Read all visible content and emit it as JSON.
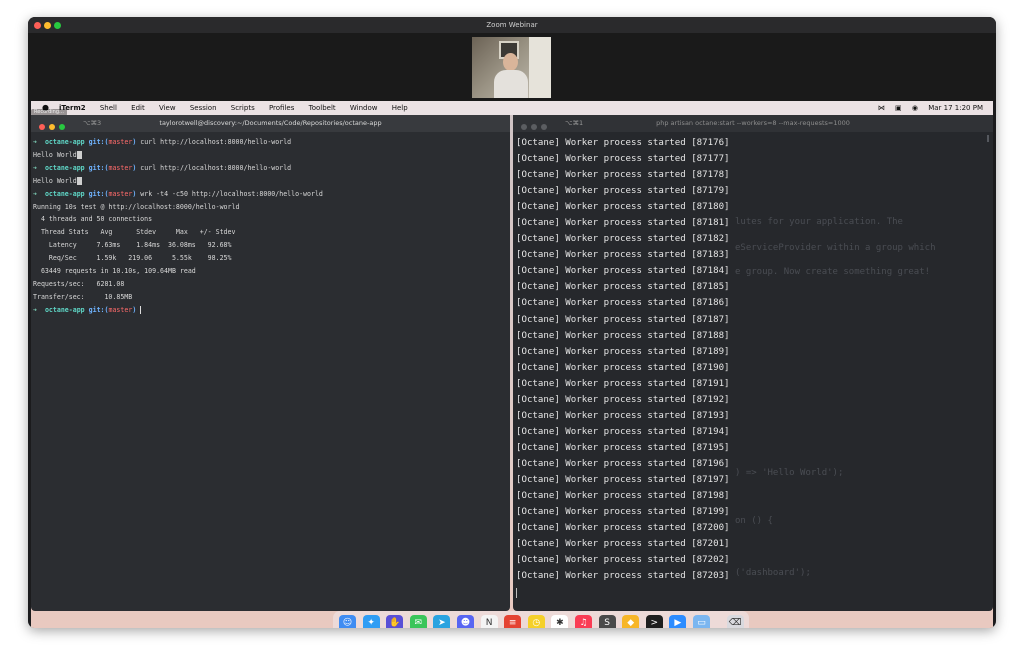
{
  "zoom": {
    "title": "Zoom Webinar"
  },
  "menubar": {
    "app": "iTerm2",
    "items": [
      "Shell",
      "Edit",
      "View",
      "Session",
      "Scripts",
      "Profiles",
      "Toolbelt",
      "Window",
      "Help"
    ],
    "datetime": "Mar 17  1:20 PM",
    "recording_badge": "Recording…"
  },
  "left_terminal": {
    "shortcut": "⌥⌘3",
    "title": "taylorotwell@discovery:~/Documents/Code/Repositories/octane-app",
    "prompt": {
      "arrow": "➜",
      "dir": "octane-app",
      "git": "git:(",
      "branch": "master",
      "close": ")"
    },
    "commands": [
      "curl http://localhost:8000/hello-world",
      "curl http://localhost:8000/hello-world",
      "wrk -t4 -c50 http://localhost:8000/hello-world"
    ],
    "responses": [
      "Hello World",
      "Hello World"
    ],
    "wrk_output": [
      "Running 10s test @ http://localhost:8000/hello-world",
      "  4 threads and 50 connections",
      "  Thread Stats   Avg      Stdev     Max   +/- Stdev",
      "    Latency     7.63ms    1.84ms  36.08ms   92.68%",
      "    Req/Sec     1.59k   219.06     5.55k    98.25%",
      "  63449 requests in 10.10s, 109.64MB read",
      "Requests/sec:   6281.08",
      "Transfer/sec:     10.85MB"
    ]
  },
  "right_terminal": {
    "shortcut": "⌥⌘1",
    "title": "php artisan octane:start --workers=8 --max-requests=1000",
    "workers_prefix": "[Octane] Worker process started",
    "worker_ids": [
      87176,
      87177,
      87178,
      87179,
      87180,
      87181,
      87182,
      87183,
      87184,
      87185,
      87186,
      87187,
      87188,
      87189,
      87190,
      87191,
      87192,
      87193,
      87194,
      87195,
      87196,
      87197,
      87198,
      87199,
      87200,
      87201,
      87202,
      87203
    ],
    "ghost_text": [
      "lutes for your application. The",
      "eServiceProvider within a group which",
      "e group. Now create something great!",
      ") => 'Hello World');",
      "on () {",
      "('dashboard');"
    ]
  },
  "dock": {
    "apps": [
      {
        "name": "finder-icon",
        "color": "#3f8cf2",
        "glyph": "☺"
      },
      {
        "name": "safari-icon",
        "color": "#2f9df4",
        "glyph": "✦"
      },
      {
        "name": "hand-app-icon",
        "color": "#5a4fd6",
        "glyph": "✋"
      },
      {
        "name": "messages-icon",
        "color": "#3bc55a",
        "glyph": "✉"
      },
      {
        "name": "telegram-icon",
        "color": "#2aa3e0",
        "glyph": "➤"
      },
      {
        "name": "discord-icon",
        "color": "#5865f2",
        "glyph": "☻"
      },
      {
        "name": "notion-icon",
        "color": "#f4f4f4",
        "glyph": "N"
      },
      {
        "name": "todoist-icon",
        "color": "#e44332",
        "glyph": "≡"
      },
      {
        "name": "timing-icon",
        "color": "#f5d02a",
        "glyph": "◷"
      },
      {
        "name": "slack-icon",
        "color": "#ffffff",
        "glyph": "✱"
      },
      {
        "name": "music-icon",
        "color": "#fa3c54",
        "glyph": "♫"
      },
      {
        "name": "sublime-icon",
        "color": "#4a4a4a",
        "glyph": "S"
      },
      {
        "name": "sketch-icon",
        "color": "#f7b628",
        "glyph": "◆"
      },
      {
        "name": "terminal-icon",
        "color": "#1e1e1e",
        "glyph": ">"
      },
      {
        "name": "zoom-icon",
        "color": "#2d8cff",
        "glyph": "▶"
      },
      {
        "name": "folder-icon",
        "color": "#7bb6f0",
        "glyph": "▭"
      },
      {
        "name": "trash-icon",
        "color": "#d9d9de",
        "glyph": "⌫"
      }
    ]
  }
}
